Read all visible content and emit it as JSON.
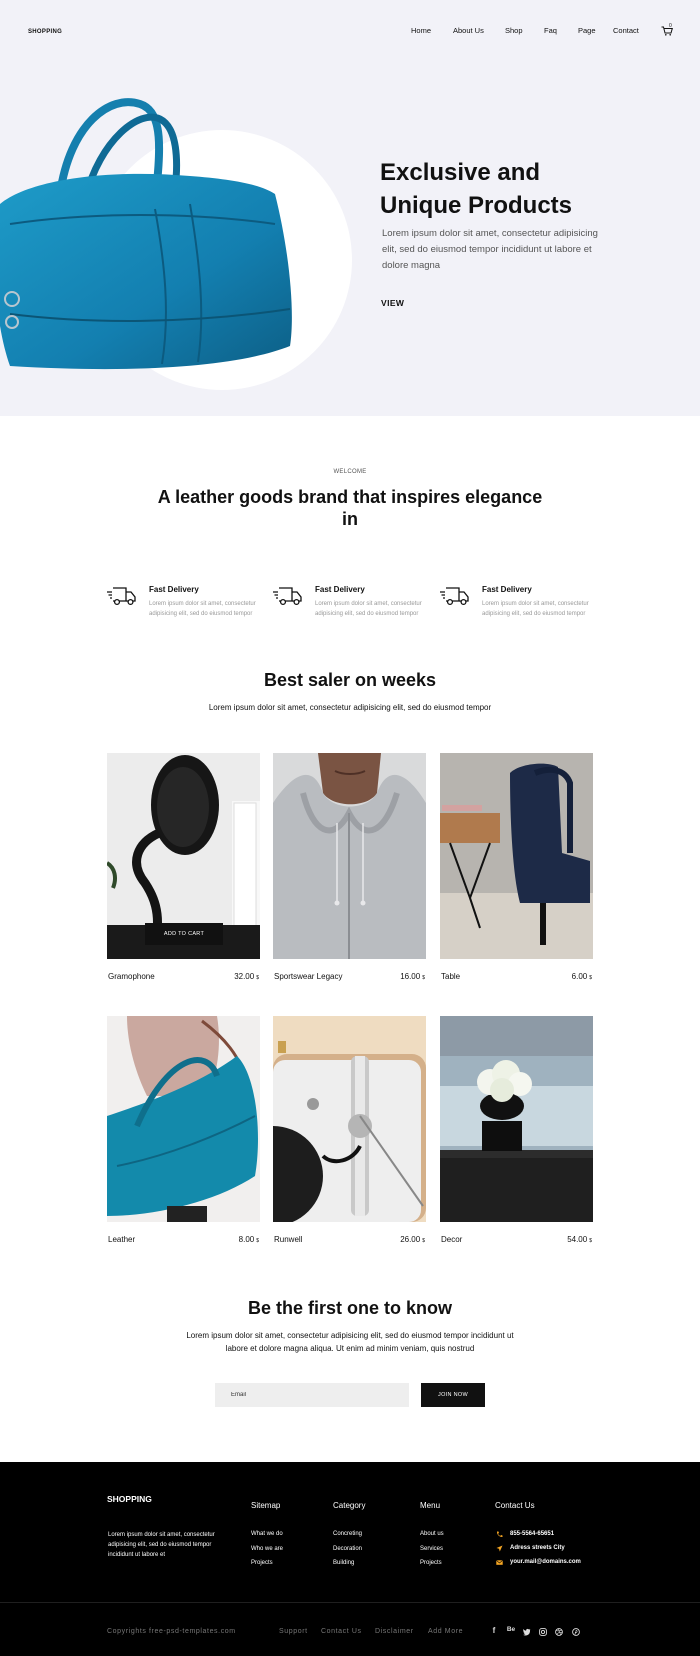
{
  "header": {
    "logo": "SHOPPING",
    "nav": [
      "Home",
      "About Us",
      "Shop",
      "Faq",
      "Page",
      "Contact"
    ],
    "cart_count": "0"
  },
  "hero": {
    "title_line1": "Exclusive and",
    "title_line2": "Unique Products",
    "text": "Lorem ipsum dolor sit amet, consectetur adipisicing elit, sed do eiusmod tempor incididunt ut labore et dolore magna",
    "cta": "VIEW"
  },
  "welcome": {
    "eyebrow": "WELCOME",
    "title": "A leather goods brand that inspires elegance in"
  },
  "features": [
    {
      "icon": "delivery-truck-icon",
      "title": "Fast Delivery",
      "text": "Lorem ipsum dolor sit amet, consectetur adipisicing elit, sed do eiusmod tempor"
    },
    {
      "icon": "delivery-truck-icon",
      "title": "Fast Delivery",
      "text": "Lorem ipsum dolor sit amet, consectetur adipisicing elit, sed do eiusmod tempor"
    },
    {
      "icon": "delivery-truck-icon",
      "title": "Fast Delivery",
      "text": "Lorem ipsum dolor sit amet, consectetur adipisicing elit, sed do eiusmod tempor"
    }
  ],
  "best": {
    "title": "Best saler on weeks",
    "subtitle": "Lorem ipsum dolor sit amet, consectetur adipisicing elit, sed do eiusmod tempor",
    "add_to_cart": "ADD TO CART",
    "currency": "$",
    "products": [
      {
        "name": "Gramophone",
        "price": "32.00"
      },
      {
        "name": "Sportswear Legacy",
        "price": "16.00"
      },
      {
        "name": "Table",
        "price": "6.00"
      },
      {
        "name": "Leather",
        "price": "8.00"
      },
      {
        "name": "Runwell",
        "price": "26.00"
      },
      {
        "name": "Decor",
        "price": "54.00"
      }
    ]
  },
  "newsletter": {
    "title": "Be the first one to know",
    "text": "Lorem ipsum dolor sit amet, consectetur adipisicing elit, sed do eiusmod tempor incididunt ut labore et dolore magna aliqua. Ut enim ad minim veniam, quis nostrud",
    "placeholder": "Email",
    "button": "JOIN NOW"
  },
  "footer": {
    "brand": "SHOPPING",
    "about": "Lorem ipsum dolor sit amet, consectetur adipisicing elit, sed do eiusmod tempor incididunt ut labore et",
    "columns": [
      {
        "title": "Sitemap",
        "links": [
          "What we do",
          "Who we are",
          "Projects"
        ]
      },
      {
        "title": "Category",
        "links": [
          "Concreting",
          "Decoration",
          "Building"
        ]
      },
      {
        "title": "Menu",
        "links": [
          "About us",
          "Services",
          "Projects"
        ]
      }
    ],
    "contact": {
      "title": "Contact Us",
      "phone": "855-5564-65651",
      "address": "Adress streets City",
      "email": "your.mail@domains.com"
    },
    "copyright": "Copyrights free-psd-templates.com",
    "bottom_links": [
      "Support",
      "Contact Us",
      "Disclaimer",
      "Add More"
    ],
    "social": [
      "facebook-icon",
      "behance-icon",
      "twitter-icon",
      "instagram-icon",
      "dribbble-icon",
      "pinterest-icon"
    ],
    "accent": "#f5a623"
  }
}
